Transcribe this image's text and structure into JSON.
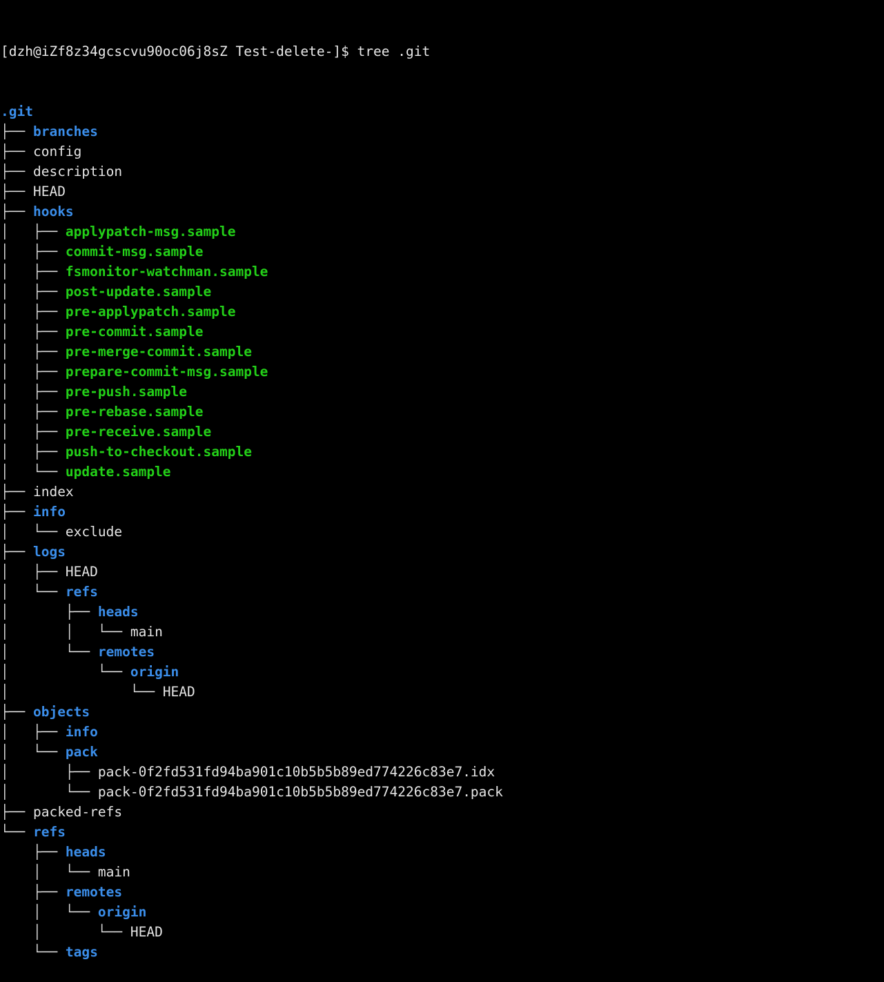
{
  "terminal": {
    "title": "tree .git",
    "background_color": "#000000",
    "foreground_color": "#e5e5e5",
    "dir_color": "#3b8eea",
    "exec_color": "#23d018",
    "branch_color": "#d8d8d8"
  },
  "prompt": {
    "full_line": "[dzh@iZf8z34gcscvu90oc06j8sZ Test-delete-]$ tree .git",
    "user": "dzh",
    "host": "iZf8z34gcscvu90oc06j8sZ",
    "cwd": "Test-delete-",
    "symbol": "$",
    "command": "tree .git"
  },
  "tree": {
    "root": ".git",
    "root_type": "dir",
    "lines": [
      {
        "prefix": "",
        "name": ".git",
        "type": "dir"
      },
      {
        "prefix": "├── ",
        "name": "branches",
        "type": "dir"
      },
      {
        "prefix": "├── ",
        "name": "config",
        "type": "file"
      },
      {
        "prefix": "├── ",
        "name": "description",
        "type": "file"
      },
      {
        "prefix": "├── ",
        "name": "HEAD",
        "type": "file"
      },
      {
        "prefix": "├── ",
        "name": "hooks",
        "type": "dir"
      },
      {
        "prefix": "│   ├── ",
        "name": "applypatch-msg.sample",
        "type": "exec"
      },
      {
        "prefix": "│   ├── ",
        "name": "commit-msg.sample",
        "type": "exec"
      },
      {
        "prefix": "│   ├── ",
        "name": "fsmonitor-watchman.sample",
        "type": "exec"
      },
      {
        "prefix": "│   ├── ",
        "name": "post-update.sample",
        "type": "exec"
      },
      {
        "prefix": "│   ├── ",
        "name": "pre-applypatch.sample",
        "type": "exec"
      },
      {
        "prefix": "│   ├── ",
        "name": "pre-commit.sample",
        "type": "exec"
      },
      {
        "prefix": "│   ├── ",
        "name": "pre-merge-commit.sample",
        "type": "exec"
      },
      {
        "prefix": "│   ├── ",
        "name": "prepare-commit-msg.sample",
        "type": "exec"
      },
      {
        "prefix": "│   ├── ",
        "name": "pre-push.sample",
        "type": "exec"
      },
      {
        "prefix": "│   ├── ",
        "name": "pre-rebase.sample",
        "type": "exec"
      },
      {
        "prefix": "│   ├── ",
        "name": "pre-receive.sample",
        "type": "exec"
      },
      {
        "prefix": "│   ├── ",
        "name": "push-to-checkout.sample",
        "type": "exec"
      },
      {
        "prefix": "│   └── ",
        "name": "update.sample",
        "type": "exec"
      },
      {
        "prefix": "├── ",
        "name": "index",
        "type": "file"
      },
      {
        "prefix": "├── ",
        "name": "info",
        "type": "dir"
      },
      {
        "prefix": "│   └── ",
        "name": "exclude",
        "type": "file"
      },
      {
        "prefix": "├── ",
        "name": "logs",
        "type": "dir"
      },
      {
        "prefix": "│   ├── ",
        "name": "HEAD",
        "type": "file"
      },
      {
        "prefix": "│   └── ",
        "name": "refs",
        "type": "dir"
      },
      {
        "prefix": "│       ├── ",
        "name": "heads",
        "type": "dir"
      },
      {
        "prefix": "│       │   └── ",
        "name": "main",
        "type": "file"
      },
      {
        "prefix": "│       └── ",
        "name": "remotes",
        "type": "dir"
      },
      {
        "prefix": "│           └── ",
        "name": "origin",
        "type": "dir"
      },
      {
        "prefix": "│               └── ",
        "name": "HEAD",
        "type": "file"
      },
      {
        "prefix": "├── ",
        "name": "objects",
        "type": "dir"
      },
      {
        "prefix": "│   ├── ",
        "name": "info",
        "type": "dir"
      },
      {
        "prefix": "│   └── ",
        "name": "pack",
        "type": "dir"
      },
      {
        "prefix": "│       ├── ",
        "name": "pack-0f2fd531fd94ba901c10b5b5b89ed774226c83e7.idx",
        "type": "file"
      },
      {
        "prefix": "│       └── ",
        "name": "pack-0f2fd531fd94ba901c10b5b5b89ed774226c83e7.pack",
        "type": "file"
      },
      {
        "prefix": "├── ",
        "name": "packed-refs",
        "type": "file"
      },
      {
        "prefix": "└── ",
        "name": "refs",
        "type": "dir"
      },
      {
        "prefix": "    ├── ",
        "name": "heads",
        "type": "dir"
      },
      {
        "prefix": "    │   └── ",
        "name": "main",
        "type": "file"
      },
      {
        "prefix": "    ├── ",
        "name": "remotes",
        "type": "dir"
      },
      {
        "prefix": "    │   └── ",
        "name": "origin",
        "type": "dir"
      },
      {
        "prefix": "    │       └── ",
        "name": "HEAD",
        "type": "file"
      },
      {
        "prefix": "    └── ",
        "name": "tags",
        "type": "dir"
      }
    ]
  }
}
